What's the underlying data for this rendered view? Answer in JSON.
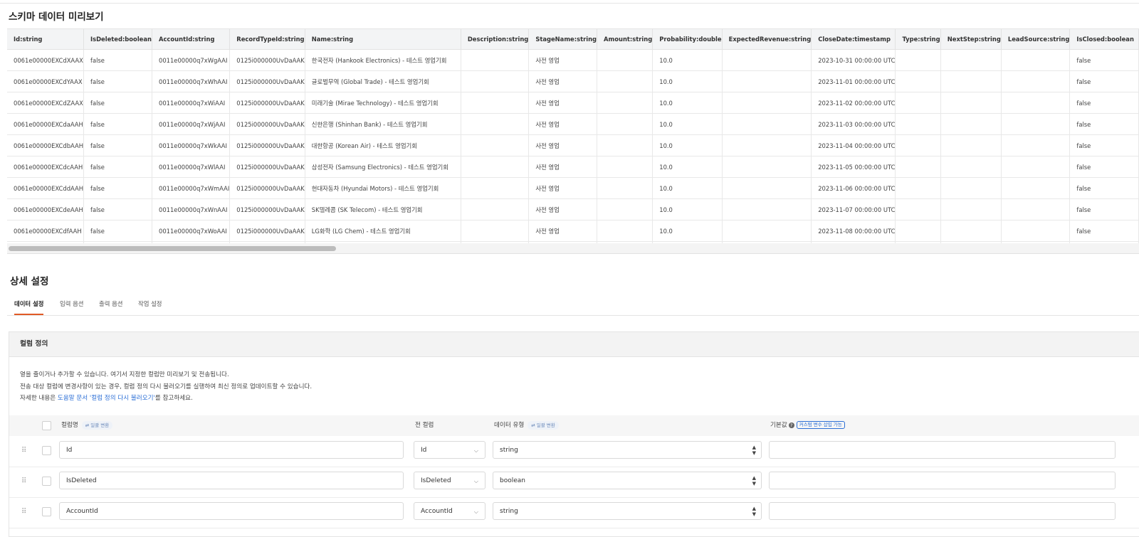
{
  "preview": {
    "title": "스키마 데이터 미리보기",
    "columns": [
      "Id:string",
      "IsDeleted:boolean",
      "AccountId:string",
      "RecordTypeId:string",
      "Name:string",
      "Description:string",
      "StageName:string",
      "Amount:string",
      "Probability:double",
      "ExpectedRevenue:string",
      "CloseDate:timestamp",
      "Type:string",
      "NextStep:string",
      "LeadSource:string",
      "IsClosed:boolean"
    ],
    "rows": [
      [
        "0061e00000EXCdXAAX",
        "false",
        "0011e00000q7xWgAAI",
        "0125i000000UvDaAAK",
        "한국전자 (Hankook Electronics) - 테스트 영업기회",
        "",
        "사전 영업",
        "",
        "10.0",
        "",
        "2023-10-31 00:00:00 UTC",
        "",
        "",
        "",
        "false"
      ],
      [
        "0061e00000EXCdYAAX",
        "false",
        "0011e00000q7xWhAAI",
        "0125i000000UvDaAAK",
        "글로벌무역 (Global Trade) - 테스트 영업기회",
        "",
        "사전 영업",
        "",
        "10.0",
        "",
        "2023-11-01 00:00:00 UTC",
        "",
        "",
        "",
        "false"
      ],
      [
        "0061e00000EXCdZAAX",
        "false",
        "0011e00000q7xWiAAI",
        "0125i000000UvDaAAK",
        "미래기술 (Mirae Technology) - 테스트 영업기회",
        "",
        "사전 영업",
        "",
        "10.0",
        "",
        "2023-11-02 00:00:00 UTC",
        "",
        "",
        "",
        "false"
      ],
      [
        "0061e00000EXCdaAAH",
        "false",
        "0011e00000q7xWjAAI",
        "0125i000000UvDaAAK",
        "신한은행 (Shinhan Bank) - 테스트 영업기회",
        "",
        "사전 영업",
        "",
        "10.0",
        "",
        "2023-11-03 00:00:00 UTC",
        "",
        "",
        "",
        "false"
      ],
      [
        "0061e00000EXCdbAAH",
        "false",
        "0011e00000q7xWkAAI",
        "0125i000000UvDaAAK",
        "대한항공 (Korean Air) - 테스트 영업기회",
        "",
        "사전 영업",
        "",
        "10.0",
        "",
        "2023-11-04 00:00:00 UTC",
        "",
        "",
        "",
        "false"
      ],
      [
        "0061e00000EXCdcAAH",
        "false",
        "0011e00000q7xWlAAI",
        "0125i000000UvDaAAK",
        "삼성전자 (Samsung Electronics) - 테스트 영업기회",
        "",
        "사전 영업",
        "",
        "10.0",
        "",
        "2023-11-05 00:00:00 UTC",
        "",
        "",
        "",
        "false"
      ],
      [
        "0061e00000EXCddAAH",
        "false",
        "0011e00000q7xWmAAI",
        "0125i000000UvDaAAK",
        "현대자동차 (Hyundai Motors) - 테스트 영업기회",
        "",
        "사전 영업",
        "",
        "10.0",
        "",
        "2023-11-06 00:00:00 UTC",
        "",
        "",
        "",
        "false"
      ],
      [
        "0061e00000EXCdeAAH",
        "false",
        "0011e00000q7xWnAAI",
        "0125i000000UvDaAAK",
        "SK텔레콤 (SK Telecom) - 테스트 영업기회",
        "",
        "사전 영업",
        "",
        "10.0",
        "",
        "2023-11-07 00:00:00 UTC",
        "",
        "",
        "",
        "false"
      ],
      [
        "0061e00000EXCdfAAH",
        "false",
        "0011e00000q7xWoAAI",
        "0125i000000UvDaAAK",
        "LG화학 (LG Chem) - 테스트 영업기회",
        "",
        "사전 영업",
        "",
        "10.0",
        "",
        "2023-11-08 00:00:00 UTC",
        "",
        "",
        "",
        "false"
      ],
      [
        "",
        "",
        "",
        "",
        "",
        "",
        "",
        "",
        "",
        "",
        "",
        "",
        "",
        "",
        ""
      ]
    ]
  },
  "settings": {
    "title": "상세 설정",
    "tabs": [
      "데이터 설정",
      "입력 옵션",
      "출력 옵션",
      "작업 설정"
    ],
    "active_tab": "데이터 설정"
  },
  "column_def": {
    "title": "컬럼 정의",
    "desc_line1": "열을 줄이거나 추가할 수 있습니다. 여기서 지정한 컬럼만 미리보기 및 전송됩니다.",
    "desc_line2": "전송 대상 컬럼에 변경사항이 있는 경우, 컬럼 정의 다시 불러오기를 실행하여 최신 정의로 업데이트할 수 있습니다.",
    "desc_line3_prefix": "자세한 내용은 ",
    "desc_line3_link": "도움말 문서 '컬럼 정의 다시 불러오기'",
    "desc_line3_suffix": "를 참고하세요.",
    "header_name": "컬럼명",
    "header_name_pill": "일괄 변환",
    "header_source": "전 컬럼",
    "header_type": "데이터 유형",
    "header_type_pill": "일괄 변환",
    "header_default": "기본값",
    "header_default_tag": "커스텀 변수 삽입 가능",
    "rows": [
      {
        "name": "Id",
        "source": "Id",
        "type": "string",
        "default": ""
      },
      {
        "name": "IsDeleted",
        "source": "IsDeleted",
        "type": "boolean",
        "default": ""
      },
      {
        "name": "AccountId",
        "source": "AccountId",
        "type": "string",
        "default": ""
      }
    ]
  },
  "colors": {
    "accent": "#e05a26",
    "link": "#2c6fd6"
  }
}
